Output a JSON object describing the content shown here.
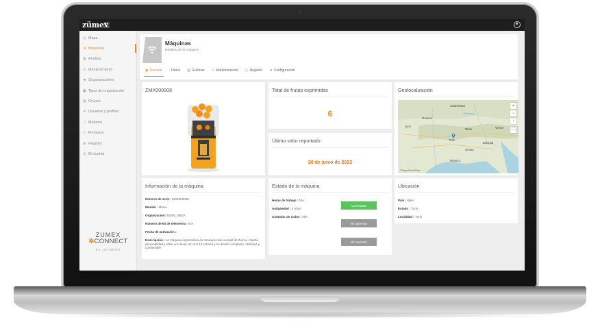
{
  "app": {
    "logo": "zümex",
    "brand_line1": "ZUMEX",
    "brand_line2": "CONNECT",
    "brand_line3": "BY IOTSENS"
  },
  "sidebar": {
    "items": [
      {
        "label": "Mapa",
        "icon": "location-pin-icon",
        "glyph": "◎",
        "active": false
      },
      {
        "label": "Máquinas",
        "icon": "wifi-icon",
        "glyph": "≋",
        "active": true
      },
      {
        "label": "Análisis",
        "icon": "bar-chart-icon",
        "glyph": "▥",
        "active": false
      },
      {
        "label": "Mantenimiento",
        "icon": "warning-icon",
        "glyph": "⚠",
        "active": false
      },
      {
        "label": "Organizaciones",
        "icon": "sitemap-icon",
        "glyph": "♣",
        "active": false
      },
      {
        "label": "Tipos de organización",
        "icon": "grid-icon",
        "glyph": "▦",
        "active": false
      },
      {
        "label": "Grupos",
        "icon": "group-icon",
        "glyph": "◍",
        "active": false
      },
      {
        "label": "Usuarios y perfiles",
        "icon": "users-icon",
        "glyph": "☍",
        "active": false
      },
      {
        "label": "Modelos",
        "icon": "device-icon",
        "glyph": "▯",
        "active": false
      },
      {
        "label": "Firmware",
        "icon": "file-icon",
        "glyph": "▢",
        "active": false
      },
      {
        "label": "Registro",
        "icon": "list-icon",
        "glyph": "☰",
        "active": false
      },
      {
        "label": "Mi cuenta",
        "icon": "user-icon",
        "glyph": "♙",
        "active": false
      }
    ]
  },
  "header": {
    "title": "Máquinas",
    "subtitle": "Detalles de la máquina",
    "tabs": [
      {
        "label": "General",
        "glyph": "▣",
        "active": true
      },
      {
        "label": "Datos",
        "glyph": "⁝",
        "active": false
      },
      {
        "label": "Gráficas",
        "glyph": "▥",
        "active": false
      },
      {
        "label": "Mantenimiento",
        "glyph": "⚠",
        "active": false
      },
      {
        "label": "Registro",
        "glyph": "▢",
        "active": false
      },
      {
        "label": "Configuración",
        "glyph": "⚙",
        "active": false
      }
    ]
  },
  "machine_card": {
    "title": "ZMX000008"
  },
  "fruits_card": {
    "title": "Total de frutas exprimidas",
    "value": "6"
  },
  "last_value_card": {
    "title": "Último valor reportado",
    "value": "20 de junio de 2022"
  },
  "geo_card": {
    "title": "Geolocalización",
    "map_labels": {
      "switzerland": "Switzerland",
      "milan": "Milan",
      "genoa": "Genoa",
      "monaco": "Monaco",
      "turin": "Turin",
      "lyon": "Lyon",
      "geneva": "Geneva",
      "venice": "Venice",
      "bologna": "Bologna"
    },
    "zoom_in": "+",
    "zoom_out": "−",
    "attribution": "©OpenStreetMap"
  },
  "info_card": {
    "title": "Información de la máquina",
    "fields": [
      {
        "label": "Número de serie :",
        "value": "ZMX000008"
      },
      {
        "label": "Modelo :",
        "value": "Minex"
      },
      {
        "label": "Organización:",
        "value": "ESSELUNGA"
      },
      {
        "label": "Número de kit de telemetría :",
        "value": "N/A"
      },
      {
        "label": "Fecha de activación :",
        "value": ""
      }
    ],
    "description_label": "Descripción :",
    "description_value": "La máquina exprimidora de naranjas más versátil de Zumex. Aporta personalidad y estilo a tu local con sus 12 colores y su diseño compacto, atractivo y combinable."
  },
  "status_card": {
    "title": "Estado de la máquina",
    "fields": [
      {
        "label": "Horas de trabajo :",
        "value": "N/A"
      },
      {
        "label": "Antigüedad :",
        "value": "0 Años"
      },
      {
        "label": "Contador de ciclos :",
        "value": "N/A"
      }
    ],
    "connected_label": "Conectada",
    "alarms_label": "Sin alarmas",
    "events_label": "Sin eventos",
    "colors": {
      "connected": "#5cc45f",
      "neutral": "#9a9a9a"
    }
  },
  "location_card": {
    "title": "Ubicación",
    "fields": [
      {
        "label": "País :",
        "value": "Italia"
      },
      {
        "label": "Estado :",
        "value": "Turín"
      },
      {
        "label": "Localidad :",
        "value": "Turín"
      }
    ]
  },
  "colors": {
    "accent": "#f08a1c",
    "topbar": "#1e1e1e"
  }
}
